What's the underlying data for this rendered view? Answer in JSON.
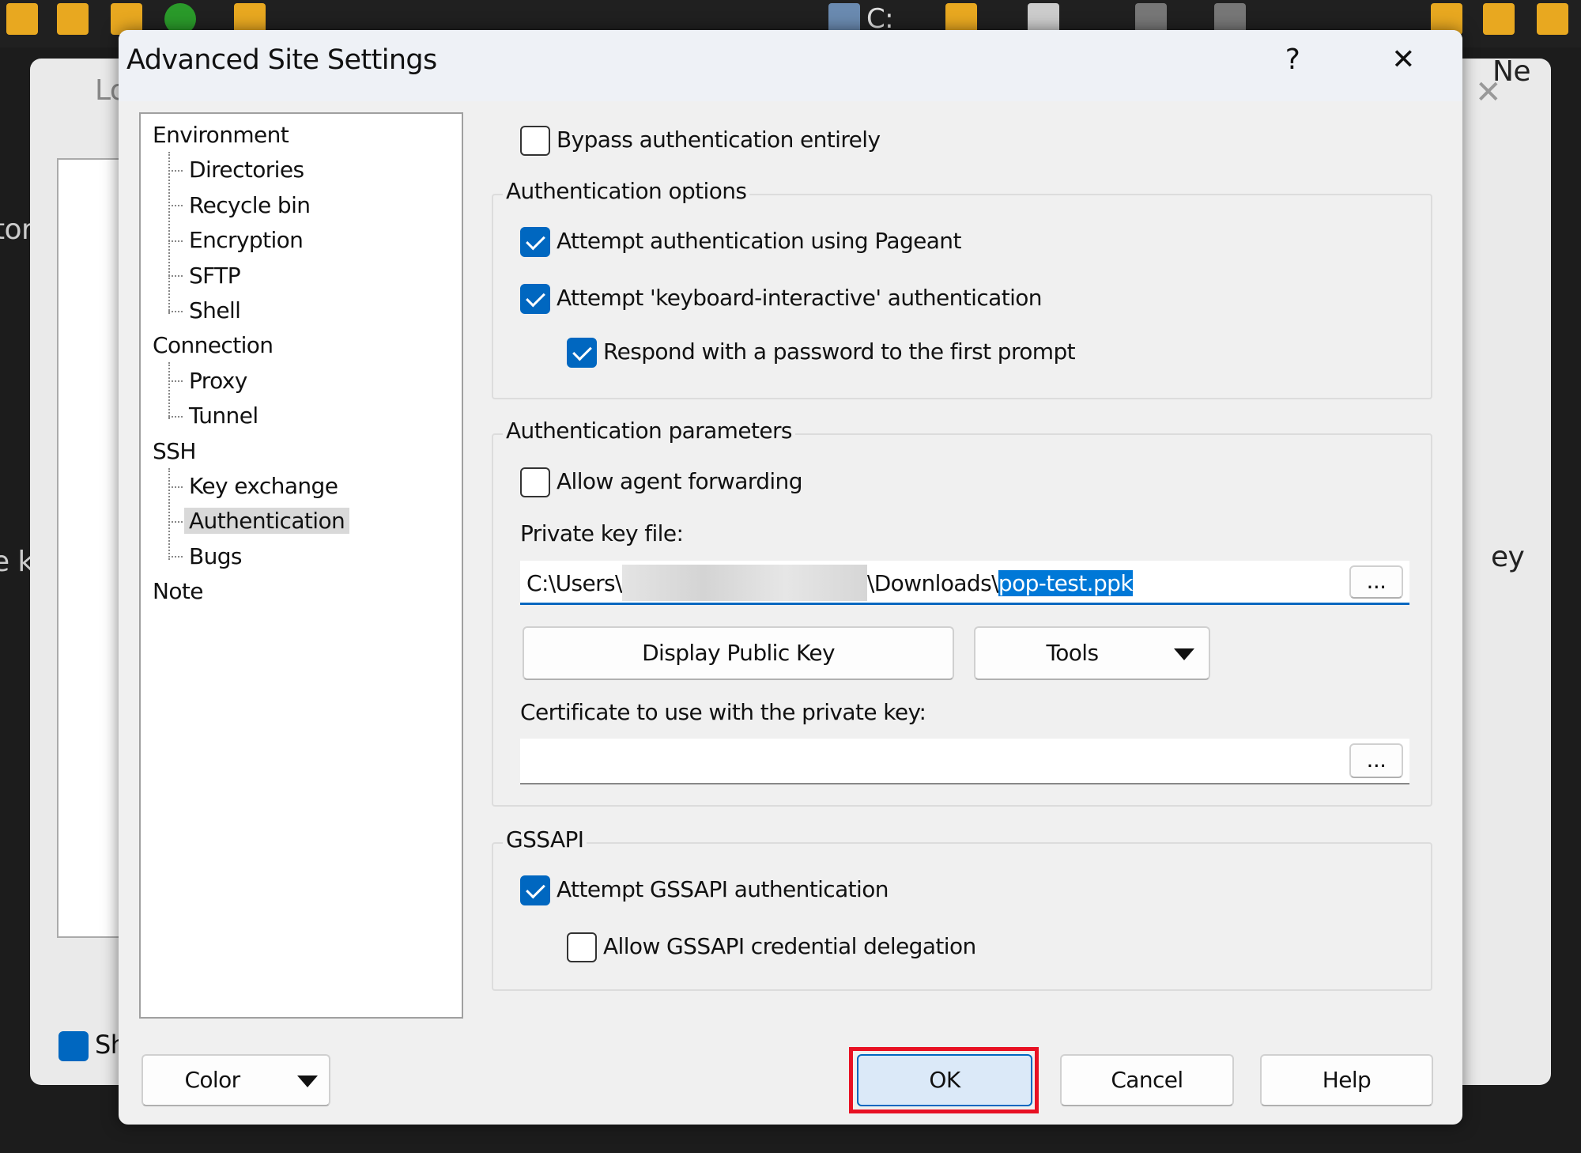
{
  "background": {
    "window_fragment_left": "Lo",
    "window_fragment_right": "Ne",
    "fragment_mid_left": "e k",
    "fragment_mid_right": "ey",
    "fragment_left": "tor",
    "checkbox_fragment": "Sh",
    "drive_label": "C:"
  },
  "dialog": {
    "title": "Advanced Site Settings",
    "help_glyph": "?",
    "close_glyph": "✕",
    "tree": [
      {
        "label": "Environment",
        "level": 0
      },
      {
        "label": "Directories",
        "level": 1
      },
      {
        "label": "Recycle bin",
        "level": 1
      },
      {
        "label": "Encryption",
        "level": 1
      },
      {
        "label": "SFTP",
        "level": 1
      },
      {
        "label": "Shell",
        "level": 1
      },
      {
        "label": "Connection",
        "level": 0
      },
      {
        "label": "Proxy",
        "level": 1
      },
      {
        "label": "Tunnel",
        "level": 1
      },
      {
        "label": "SSH",
        "level": 0
      },
      {
        "label": "Key exchange",
        "level": 1
      },
      {
        "label": "Authentication",
        "level": 1,
        "selected": true
      },
      {
        "label": "Bugs",
        "level": 1
      },
      {
        "label": "Note",
        "level": 0
      }
    ],
    "bypass": {
      "label": "Bypass authentication entirely",
      "checked": false
    },
    "auth_options": {
      "title": "Authentication options",
      "pageant": {
        "label": "Attempt authentication using Pageant",
        "checked": true
      },
      "keyboard": {
        "label": "Attempt 'keyboard-interactive' authentication",
        "checked": true
      },
      "respond": {
        "label": "Respond with a password to the first prompt",
        "checked": true
      }
    },
    "auth_params": {
      "title": "Authentication parameters",
      "agent_forwarding": {
        "label": "Allow agent forwarding",
        "checked": false
      },
      "private_key_label": "Private key file:",
      "private_key_prefix": "C:\\Users\\",
      "private_key_middle": "\\Downloads\\",
      "private_key_selected": "pop-test.ppk",
      "browse_label": "...",
      "display_public_key": "Display Public Key",
      "tools": "Tools",
      "certificate_label": "Certificate to use with the private key:",
      "certificate_value": "",
      "cert_browse_label": "..."
    },
    "gssapi": {
      "title": "GSSAPI",
      "attempt": {
        "label": "Attempt GSSAPI authentication",
        "checked": true
      },
      "delegation": {
        "label": "Allow GSSAPI credential delegation",
        "checked": false
      }
    },
    "buttons": {
      "color": "Color",
      "ok": "OK",
      "cancel": "Cancel",
      "help": "Help"
    },
    "colors": {
      "accent": "#0067c0",
      "highlight": "#e81123"
    }
  }
}
